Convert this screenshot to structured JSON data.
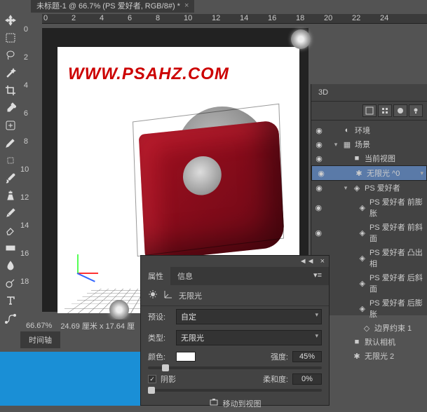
{
  "tab": {
    "title": "未标题-1 @ 66.7% (PS 爱好者, RGB/8#) *"
  },
  "ruler_h": [
    "0",
    "2",
    "4",
    "6",
    "8",
    "10",
    "12",
    "14",
    "16",
    "18",
    "20",
    "22",
    "24"
  ],
  "ruler_v": [
    "0",
    "2",
    "4",
    "6",
    "8",
    "10",
    "12",
    "14",
    "16",
    "18"
  ],
  "watermark": "WWW.PSAHZ.COM",
  "status": {
    "zoom": "66.67%",
    "dims": "24.69 厘米 x 17.64 厘"
  },
  "timeline": "时间轴",
  "panel3d": {
    "title": "3D",
    "items": [
      {
        "label": "环境",
        "icon": "env",
        "indent": 0,
        "eye": true
      },
      {
        "label": "场景",
        "icon": "scene",
        "indent": 0,
        "eye": true,
        "chev": "▾"
      },
      {
        "label": "当前视图",
        "icon": "camera",
        "indent": 1,
        "eye": true
      },
      {
        "label": "无限光  ^0",
        "icon": "light",
        "indent": 1,
        "eye": true,
        "sel": true
      },
      {
        "label": "PS 爱好者",
        "icon": "mesh",
        "indent": 1,
        "eye": true,
        "chev": "▾"
      },
      {
        "label": "PS 爱好者  前膨胀",
        "icon": "mesh",
        "indent": 2,
        "eye": true
      },
      {
        "label": "PS 爱好者  前斜面",
        "icon": "mesh",
        "indent": 2,
        "eye": true
      },
      {
        "label": "PS 爱好者  凸出相",
        "icon": "mesh",
        "indent": 2,
        "eye": true
      },
      {
        "label": "PS 爱好者  后斜面",
        "icon": "mesh",
        "indent": 2,
        "eye": true
      },
      {
        "label": "PS 爱好者  后膨胀",
        "icon": "mesh",
        "indent": 2,
        "eye": true
      },
      {
        "label": "边界约束 1",
        "icon": "constraint",
        "indent": 2,
        "eye": true
      },
      {
        "label": "默认相机",
        "icon": "camera",
        "indent": 1,
        "eye": true
      },
      {
        "label": "无限光 2",
        "icon": "light",
        "indent": 1,
        "eye": true
      }
    ]
  },
  "props": {
    "tab_props": "属性",
    "tab_info": "信息",
    "light_type_label": "无限光",
    "preset_label": "预设:",
    "preset_value": "自定",
    "type_label": "类型:",
    "type_value": "无限光",
    "color_label": "颜色:",
    "intensity_label": "强度:",
    "intensity_value": "45%",
    "shadow_label": "阴影",
    "shadow_checked": true,
    "softness_label": "柔和度:",
    "softness_value": "0%",
    "move_label": "移动到视图"
  }
}
